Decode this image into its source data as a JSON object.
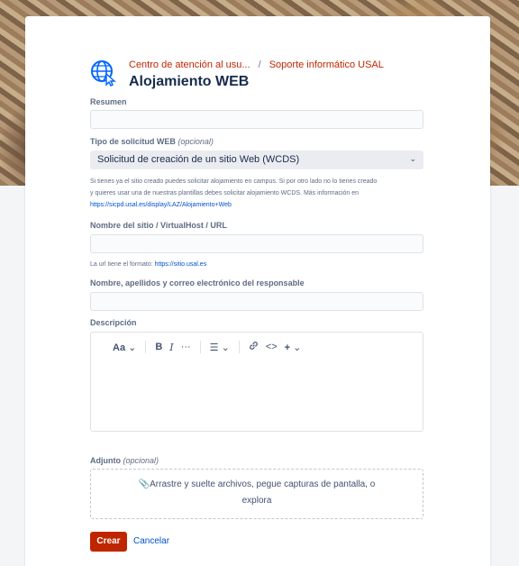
{
  "header": {
    "breadcrumb": [
      "Centro de atención al usu...",
      "Soporte informático USAL"
    ],
    "separator": "/",
    "title": "Alojamiento WEB",
    "icon": "globe-pointer-icon"
  },
  "form": {
    "summary": {
      "label": "Resumen",
      "value": ""
    },
    "request_type": {
      "label": "Tipo de solicitud WEB",
      "optional": "(opcional)",
      "value": "Solicitud de creación de un sitio Web (WCDS)",
      "help_line1": "Si tienes ya el sitio creado puedes solicitar alojamiento en campus. Si por otro lado no lo tienes creado",
      "help_line2": "y quieres usar una de nuestras plantillas debes solicitar alojamiento WCDS. Más información en",
      "help_link": "https://sicpd.usal.es/display/LAZ/Alojamiento+Web"
    },
    "site_name": {
      "label": "Nombre del sitio / VirtualHost / URL",
      "value": "",
      "help": "La url tiene el formato:",
      "help_link": "https://sitio.usal.es"
    },
    "owner": {
      "label": "Nombre, apellidos y correo electrónico del responsable",
      "value": ""
    },
    "description": {
      "label": "Descripción",
      "toolbar": {
        "text_style": "Aa",
        "bold": "B",
        "italic": "I",
        "more": "···",
        "list": "☰",
        "link": "🔗",
        "code": "<>",
        "insert": "+"
      }
    },
    "attachment": {
      "label": "Adjunto",
      "optional": "(opcional)",
      "drop_line1": "Arrastre y suelte archivos, pegue capturas de pantalla, o",
      "drop_line2": "explora"
    }
  },
  "actions": {
    "create": "Crear",
    "cancel": "Cancelar"
  },
  "colors": {
    "brand": "#bf2600",
    "link": "#0052cc",
    "globe": "#0065ff"
  }
}
